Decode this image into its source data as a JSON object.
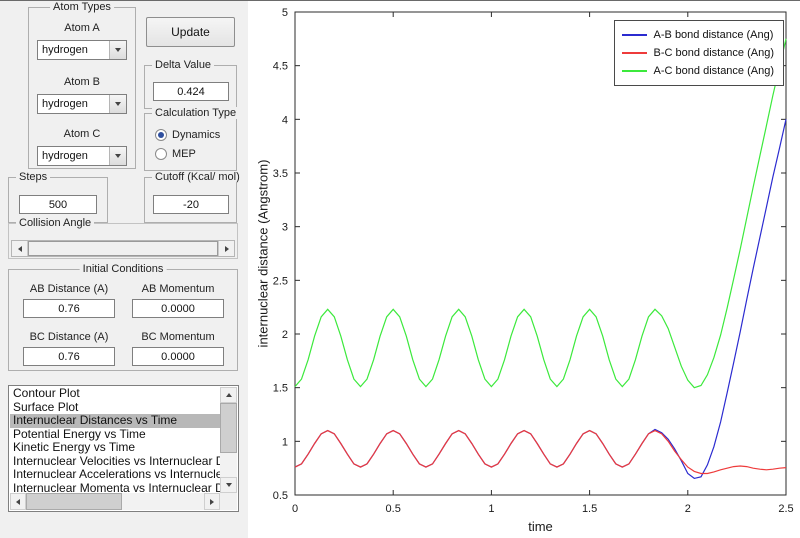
{
  "controls": {
    "atom_types": {
      "title": "Atom Types",
      "atoms": [
        {
          "label": "Atom A",
          "value": "hydrogen"
        },
        {
          "label": "Atom B",
          "value": "hydrogen"
        },
        {
          "label": "Atom C",
          "value": "hydrogen"
        }
      ]
    },
    "update_label": "Update",
    "delta": {
      "title": "Delta Value",
      "value": "0.424"
    },
    "calculation_type": {
      "title": "Calculation Type",
      "options": [
        {
          "label": "Dynamics",
          "selected": true
        },
        {
          "label": "MEP",
          "selected": false
        }
      ]
    },
    "steps": {
      "title": "Steps",
      "value": "500"
    },
    "cutoff": {
      "title": "Cutoff (Kcal/ mol)",
      "value": "-20"
    },
    "collision_angle": {
      "title": "Collision Angle"
    },
    "initial_conditions": {
      "title": "Initial Conditions",
      "fields": [
        {
          "label": "AB Distance (A)",
          "value": "0.76"
        },
        {
          "label": "AB Momentum",
          "value": "0.0000"
        },
        {
          "label": "BC Distance (A)",
          "value": "0.76"
        },
        {
          "label": "BC Momentum",
          "value": "0.0000"
        }
      ]
    },
    "plot_list": {
      "selected_index": 2,
      "items": [
        "Contour Plot",
        "Surface Plot",
        "Internuclear Distances vs Time",
        "Potential Energy vs Time",
        "Kinetic Energy vs Time",
        "Internuclear Velocities vs Internuclear Distance",
        "Internuclear Accelerations vs Internuclear Distance",
        "Internuclear Momenta vs Internuclear Distance"
      ]
    }
  },
  "chart_data": {
    "type": "line",
    "title": "",
    "xlabel": "time",
    "ylabel": "internuclear distance (Angstrom)",
    "xlim": [
      0,
      2.5
    ],
    "ylim": [
      0.5,
      5
    ],
    "xticks": [
      0,
      0.5,
      1,
      1.5,
      2,
      2.5
    ],
    "yticks": [
      0.5,
      1,
      1.5,
      2,
      2.5,
      3,
      3.5,
      4,
      4.5,
      5
    ],
    "grid": false,
    "legend_position": "top-right",
    "series": [
      {
        "name": "A-B bond distance (Ang)",
        "color": "#2b2bd0",
        "base": {
          "t0": 0,
          "dt": 0.033333,
          "y": [
            0.76,
            0.79,
            0.88,
            0.98,
            1.07,
            1.1,
            1.07,
            0.98,
            0.88,
            0.79,
            0.76,
            0.79,
            0.88,
            0.98,
            1.07,
            1.1,
            1.07,
            0.98,
            0.88,
            0.79,
            0.76,
            0.79,
            0.88,
            0.98,
            1.07,
            1.1,
            1.07,
            0.98,
            0.88,
            0.79,
            0.76,
            0.79,
            0.88,
            0.98,
            1.07,
            1.1,
            1.07,
            0.98,
            0.88,
            0.79,
            0.76,
            0.79,
            0.88,
            0.98,
            1.07,
            1.1,
            1.07,
            0.98,
            0.88,
            0.79,
            0.76,
            0.79,
            0.88,
            0.98,
            1.07
          ]
        },
        "tail": [
          [
            1.833,
            1.11
          ],
          [
            1.867,
            1.08
          ],
          [
            1.9,
            1.02
          ],
          [
            1.933,
            0.93
          ],
          [
            1.967,
            0.82
          ],
          [
            2.0,
            0.7
          ],
          [
            2.033,
            0.655
          ],
          [
            2.067,
            0.67
          ],
          [
            2.1,
            0.78
          ],
          [
            2.133,
            0.95
          ],
          [
            2.167,
            1.18
          ],
          [
            2.2,
            1.45
          ],
          [
            2.233,
            1.73
          ],
          [
            2.267,
            2.02
          ],
          [
            2.3,
            2.32
          ],
          [
            2.333,
            2.61
          ],
          [
            2.367,
            2.9
          ],
          [
            2.4,
            3.18
          ],
          [
            2.433,
            3.46
          ],
          [
            2.467,
            3.73
          ],
          [
            2.5,
            4.0
          ]
        ]
      },
      {
        "name": "B-C bond distance (Ang)",
        "color": "#ee3b3b",
        "base": {
          "t0": 0,
          "dt": 0.033333,
          "y": [
            0.76,
            0.79,
            0.88,
            0.98,
            1.07,
            1.1,
            1.07,
            0.98,
            0.88,
            0.79,
            0.76,
            0.79,
            0.88,
            0.98,
            1.07,
            1.1,
            1.07,
            0.98,
            0.88,
            0.79,
            0.76,
            0.79,
            0.88,
            0.98,
            1.07,
            1.1,
            1.07,
            0.98,
            0.88,
            0.79,
            0.76,
            0.79,
            0.88,
            0.98,
            1.07,
            1.1,
            1.07,
            0.98,
            0.88,
            0.79,
            0.76,
            0.79,
            0.88,
            0.98,
            1.07,
            1.1,
            1.07,
            0.98,
            0.88,
            0.79,
            0.76,
            0.79,
            0.88,
            0.98,
            1.07
          ]
        },
        "tail": [
          [
            1.833,
            1.1
          ],
          [
            1.867,
            1.07
          ],
          [
            1.9,
            1.0
          ],
          [
            1.933,
            0.91
          ],
          [
            1.967,
            0.83
          ],
          [
            2.0,
            0.76
          ],
          [
            2.033,
            0.72
          ],
          [
            2.067,
            0.7
          ],
          [
            2.1,
            0.7
          ],
          [
            2.133,
            0.715
          ],
          [
            2.167,
            0.735
          ],
          [
            2.2,
            0.75
          ],
          [
            2.233,
            0.765
          ],
          [
            2.267,
            0.77
          ],
          [
            2.3,
            0.765
          ],
          [
            2.333,
            0.75
          ],
          [
            2.367,
            0.74
          ],
          [
            2.4,
            0.735
          ],
          [
            2.433,
            0.74
          ],
          [
            2.467,
            0.75
          ],
          [
            2.5,
            0.755
          ]
        ]
      },
      {
        "name": "A-C bond distance (Ang)",
        "color": "#3ce93c",
        "base": {
          "t0": 0,
          "dt": 0.033333,
          "y": [
            1.51,
            1.58,
            1.76,
            1.98,
            2.16,
            2.23,
            2.16,
            1.98,
            1.76,
            1.58,
            1.51,
            1.58,
            1.76,
            1.98,
            2.16,
            2.23,
            2.16,
            1.98,
            1.76,
            1.58,
            1.51,
            1.58,
            1.76,
            1.98,
            2.16,
            2.23,
            2.16,
            1.98,
            1.76,
            1.58,
            1.51,
            1.58,
            1.76,
            1.98,
            2.16,
            2.23,
            2.16,
            1.98,
            1.76,
            1.58,
            1.51,
            1.58,
            1.76,
            1.98,
            2.16,
            2.23,
            2.16,
            1.98,
            1.76,
            1.58,
            1.51,
            1.58,
            1.76,
            1.98,
            2.16
          ]
        },
        "tail": [
          [
            1.833,
            2.23
          ],
          [
            1.867,
            2.17
          ],
          [
            1.9,
            2.05
          ],
          [
            1.933,
            1.88
          ],
          [
            1.967,
            1.7
          ],
          [
            2.0,
            1.57
          ],
          [
            2.033,
            1.5
          ],
          [
            2.067,
            1.52
          ],
          [
            2.1,
            1.62
          ],
          [
            2.133,
            1.78
          ],
          [
            2.167,
            1.99
          ],
          [
            2.2,
            2.24
          ],
          [
            2.233,
            2.51
          ],
          [
            2.267,
            2.79
          ],
          [
            2.3,
            3.08
          ],
          [
            2.333,
            3.37
          ],
          [
            2.367,
            3.66
          ],
          [
            2.4,
            3.94
          ],
          [
            2.433,
            4.22
          ],
          [
            2.467,
            4.49
          ],
          [
            2.5,
            4.75
          ]
        ]
      }
    ]
  }
}
